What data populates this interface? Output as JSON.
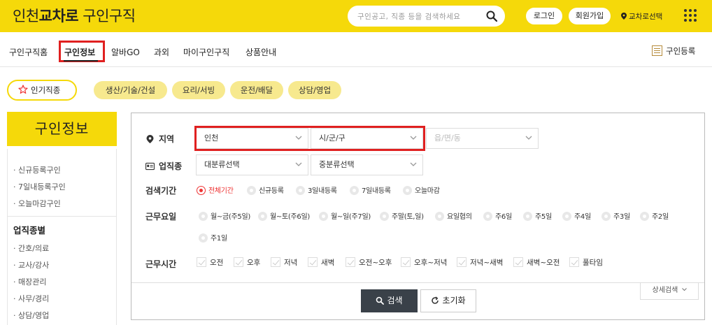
{
  "header": {
    "logo_prefix": "인천",
    "logo_brand": "교차로",
    "logo_suffix": "구인구직",
    "search_placeholder": "구인공고, 직종 등을 검색하세요",
    "login": "로그인",
    "join": "회원가입",
    "location": "교차로선택"
  },
  "nav": {
    "items": [
      "구인구직홈",
      "구인정보",
      "알바GO",
      "과외",
      "마이구인구직",
      "상품안내"
    ],
    "active": "구인정보",
    "register": "구인등록"
  },
  "popular": {
    "label": "인기직종",
    "chips": [
      "생산/기술/건설",
      "요리/서빙",
      "운전/배달",
      "상담/영업"
    ]
  },
  "sidebar": {
    "title": "구인정보",
    "quick": [
      "신규등록구인",
      "7일내등록구인",
      "오늘마감구인"
    ],
    "category_heading": "업직종별",
    "categories": [
      "간호/의료",
      "교사/강사",
      "매장관리",
      "사무/경리",
      "상담/영업"
    ]
  },
  "filters": {
    "region": {
      "label": "지역",
      "select1": "인천",
      "select2": "시/군/구",
      "select3": "읍/면/동"
    },
    "job": {
      "label": "업직종",
      "select1": "대분류선택",
      "select2": "중분류선택"
    },
    "period": {
      "label": "검색기간",
      "options": [
        "전체기간",
        "신규등록",
        "3일내등록",
        "7일내등록",
        "오늘마감"
      ],
      "selected": "전체기간"
    },
    "workdays": {
      "label": "근무요일",
      "options": [
        "월~금(주5일)",
        "월~토(주6일)",
        "월~일(주7일)",
        "주말(토,일)",
        "요일협의",
        "주6일",
        "주5일",
        "주4일",
        "주3일",
        "주2일",
        "주1일"
      ]
    },
    "worktime": {
      "label": "근무시간",
      "options": [
        "오전",
        "오후",
        "저녁",
        "새벽",
        "오전~오후",
        "오후~저녁",
        "저녁~새벽",
        "새벽~오전",
        "풀타임"
      ]
    }
  },
  "actions": {
    "search": "검색",
    "reset": "초기화",
    "detail": "상세검색"
  },
  "colors": {
    "brand_yellow": "#f5d90a",
    "chip_yellow": "#f7e98e",
    "highlight_red": "#e02020",
    "radio_red": "#e33333",
    "button_dark": "#3a4149"
  }
}
